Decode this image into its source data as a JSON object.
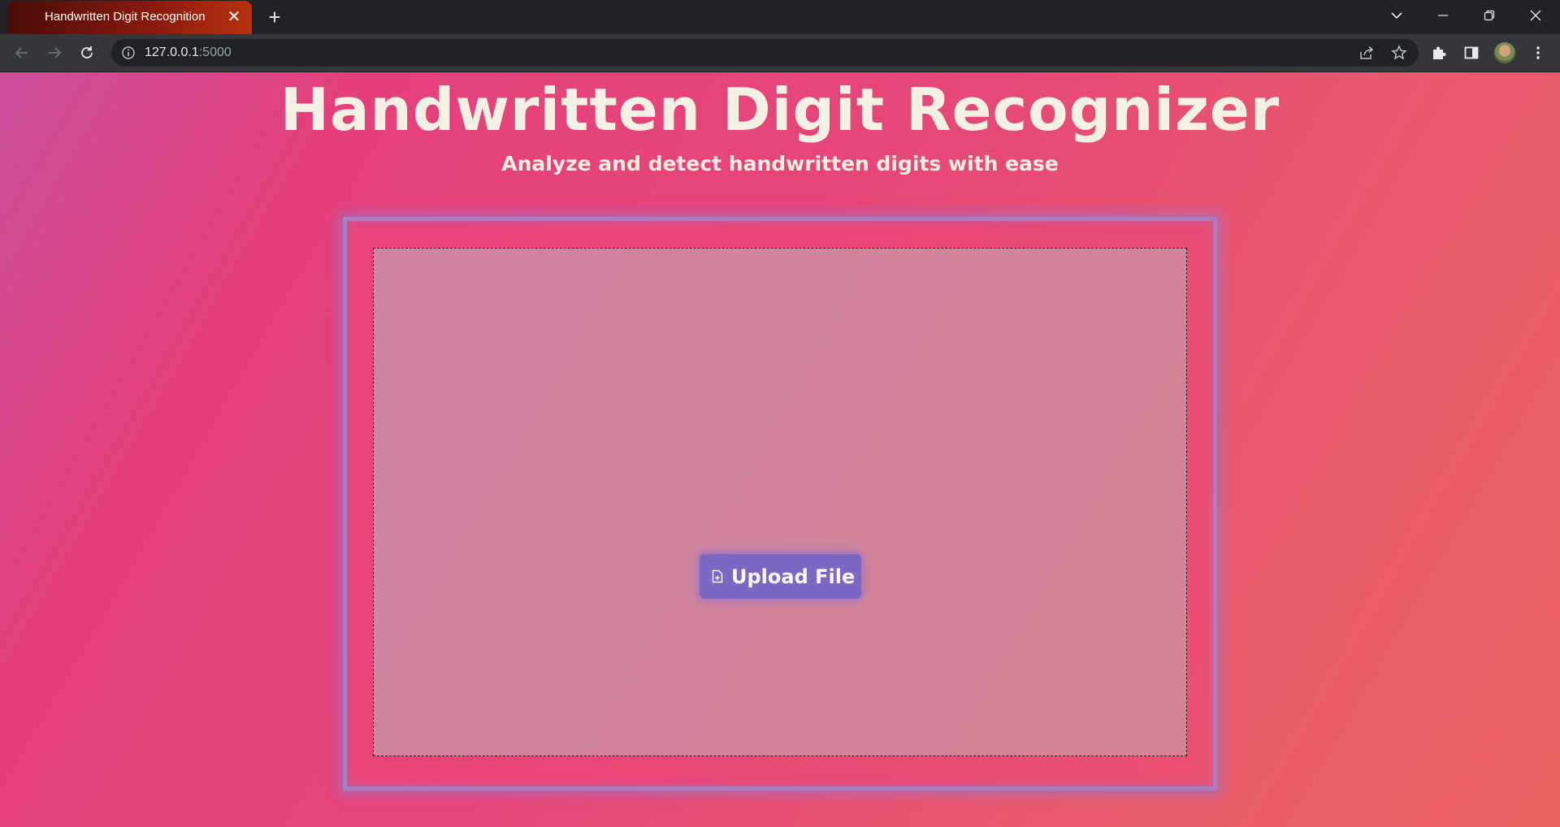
{
  "browser": {
    "tab": {
      "title": "Handwritten Digit Recognition",
      "close_symbol": "✕"
    },
    "new_tab_symbol": "+",
    "address": {
      "host": "127.0.0.1",
      "port": ":5000"
    },
    "icons": {
      "back": "back-arrow-icon",
      "forward": "forward-arrow-icon",
      "reload": "reload-icon",
      "site_info": "info-icon",
      "share": "share-icon",
      "bookmark": "star-icon",
      "extensions": "puzzle-icon",
      "side_panel": "side-panel-icon",
      "profile": "avatar",
      "menu": "kebab-menu-icon",
      "tab_search": "chevron-down-icon",
      "minimize": "minimize-icon",
      "restore": "restore-icon",
      "close": "close-icon"
    }
  },
  "page": {
    "title": "Handwritten Digit Recognizer",
    "subtitle": "Analyze and detect handwritten digits with ease",
    "upload": {
      "button_label": "Upload File",
      "icon": "file-plus-icon"
    },
    "colors": {
      "background_start": "#c94e9a",
      "background_mid": "#e6457a",
      "background_end": "#ea6060",
      "title_text": "#f3f1e3",
      "button": "#7a68c2",
      "card_border": "#a97ec0"
    }
  }
}
